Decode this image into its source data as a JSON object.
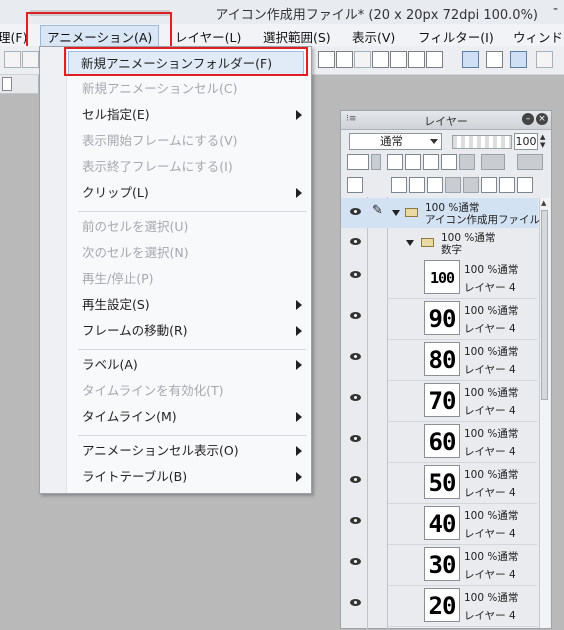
{
  "window": {
    "title": "アイコン作成用ファイル* (20 x 20px 72dpi 100.0%)",
    "minimize": "-"
  },
  "menubar": {
    "items": [
      {
        "label": "理(F)"
      },
      {
        "label": "アニメーション(A)"
      },
      {
        "label": "レイヤー(L)"
      },
      {
        "label": "選択範囲(S)"
      },
      {
        "label": "表示(V)"
      },
      {
        "label": "フィルター(I)"
      },
      {
        "label": "ウィンド"
      }
    ]
  },
  "animation_menu": {
    "items": [
      {
        "label": "新規アニメーションフォルダー(F)",
        "enabled": true,
        "submenu": false,
        "highlighted": true
      },
      {
        "label": "新規アニメーションセル(C)",
        "enabled": false,
        "submenu": false
      },
      {
        "label": "セル指定(E)",
        "enabled": true,
        "submenu": true
      },
      {
        "label": "表示開始フレームにする(V)",
        "enabled": false,
        "submenu": false
      },
      {
        "label": "表示終了フレームにする(I)",
        "enabled": false,
        "submenu": false
      },
      {
        "label": "クリップ(L)",
        "enabled": true,
        "submenu": true
      },
      {
        "label": "前のセルを選択(U)",
        "enabled": false,
        "submenu": false
      },
      {
        "label": "次のセルを選択(N)",
        "enabled": false,
        "submenu": false
      },
      {
        "label": "再生/停止(P)",
        "enabled": false,
        "submenu": false
      },
      {
        "label": "再生設定(S)",
        "enabled": true,
        "submenu": true
      },
      {
        "label": "フレームの移動(R)",
        "enabled": true,
        "submenu": true
      },
      {
        "label": "ラベル(A)",
        "enabled": true,
        "submenu": true
      },
      {
        "label": "タイムラインを有効化(T)",
        "enabled": false,
        "submenu": false
      },
      {
        "label": "タイムライン(M)",
        "enabled": true,
        "submenu": true
      },
      {
        "label": "アニメーションセル表示(O)",
        "enabled": true,
        "submenu": true
      },
      {
        "label": "ライトテーブル(B)",
        "enabled": true,
        "submenu": true
      }
    ]
  },
  "layer_panel": {
    "title": "レイヤー",
    "blend_mode": "通常",
    "opacity": "100",
    "folders": [
      {
        "line1": "100 %通常",
        "line2": "アイコン作成用ファイル"
      },
      {
        "line1": "100 %通常",
        "line2": "数字"
      }
    ],
    "layers": [
      {
        "thumb": "100",
        "mode": "100 %通常",
        "name": "レイヤー 4"
      },
      {
        "thumb": "90",
        "mode": "100 %通常",
        "name": "レイヤー 4"
      },
      {
        "thumb": "80",
        "mode": "100 %通常",
        "name": "レイヤー 4"
      },
      {
        "thumb": "70",
        "mode": "100 %通常",
        "name": "レイヤー 4"
      },
      {
        "thumb": "60",
        "mode": "100 %通常",
        "name": "レイヤー 4"
      },
      {
        "thumb": "50",
        "mode": "100 %通常",
        "name": "レイヤー 4"
      },
      {
        "thumb": "40",
        "mode": "100 %通常",
        "name": "レイヤー 4"
      },
      {
        "thumb": "30",
        "mode": "100 %通常",
        "name": "レイヤー 4"
      },
      {
        "thumb": "20",
        "mode": "100 %通常",
        "name": "レイヤー 4"
      }
    ]
  },
  "colors": {
    "highlight_box": "#e02020",
    "menu_hover": "#e0ebf7",
    "disabled_text": "#a4a8ae"
  }
}
